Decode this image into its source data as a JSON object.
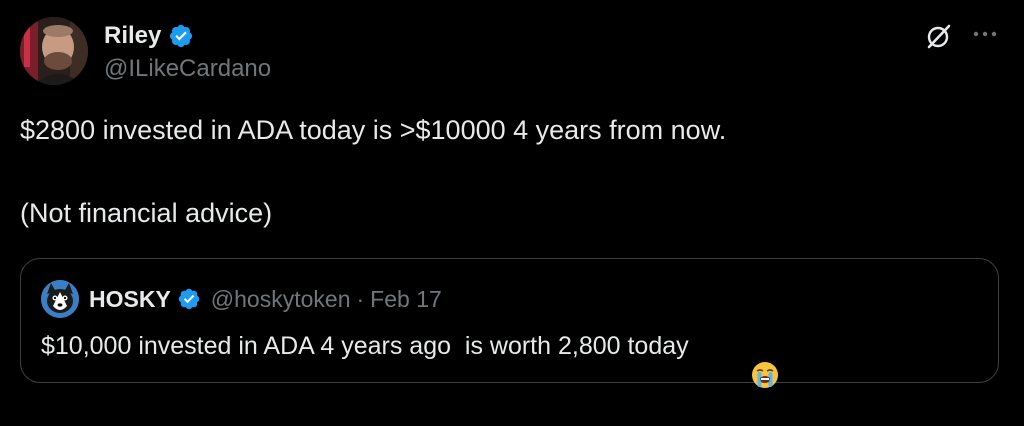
{
  "tweet": {
    "author": {
      "display_name": "Riley",
      "handle": "@ILikeCardano",
      "verified": true
    },
    "text_line1": "$2800 invested in ADA today is >$10000 4 years from now.",
    "text_line2": "(Not financial advice)",
    "icons": {
      "grok": "grok-icon",
      "more": "more-icon"
    }
  },
  "quoted_tweet": {
    "author": {
      "display_name": "HOSKY",
      "handle": "@hoskytoken",
      "verified": true
    },
    "separator": "·",
    "date": "Feb 17",
    "text": "$10,000 invested in ADA 4 years ago  is worth 2,800 today",
    "emoji": "loudly-crying-face"
  },
  "colors": {
    "background": "#000000",
    "text_primary": "#e7e9ea",
    "text_secondary": "#71767b",
    "verified_blue": "#1d9bf0",
    "border": "#3b3f43"
  }
}
